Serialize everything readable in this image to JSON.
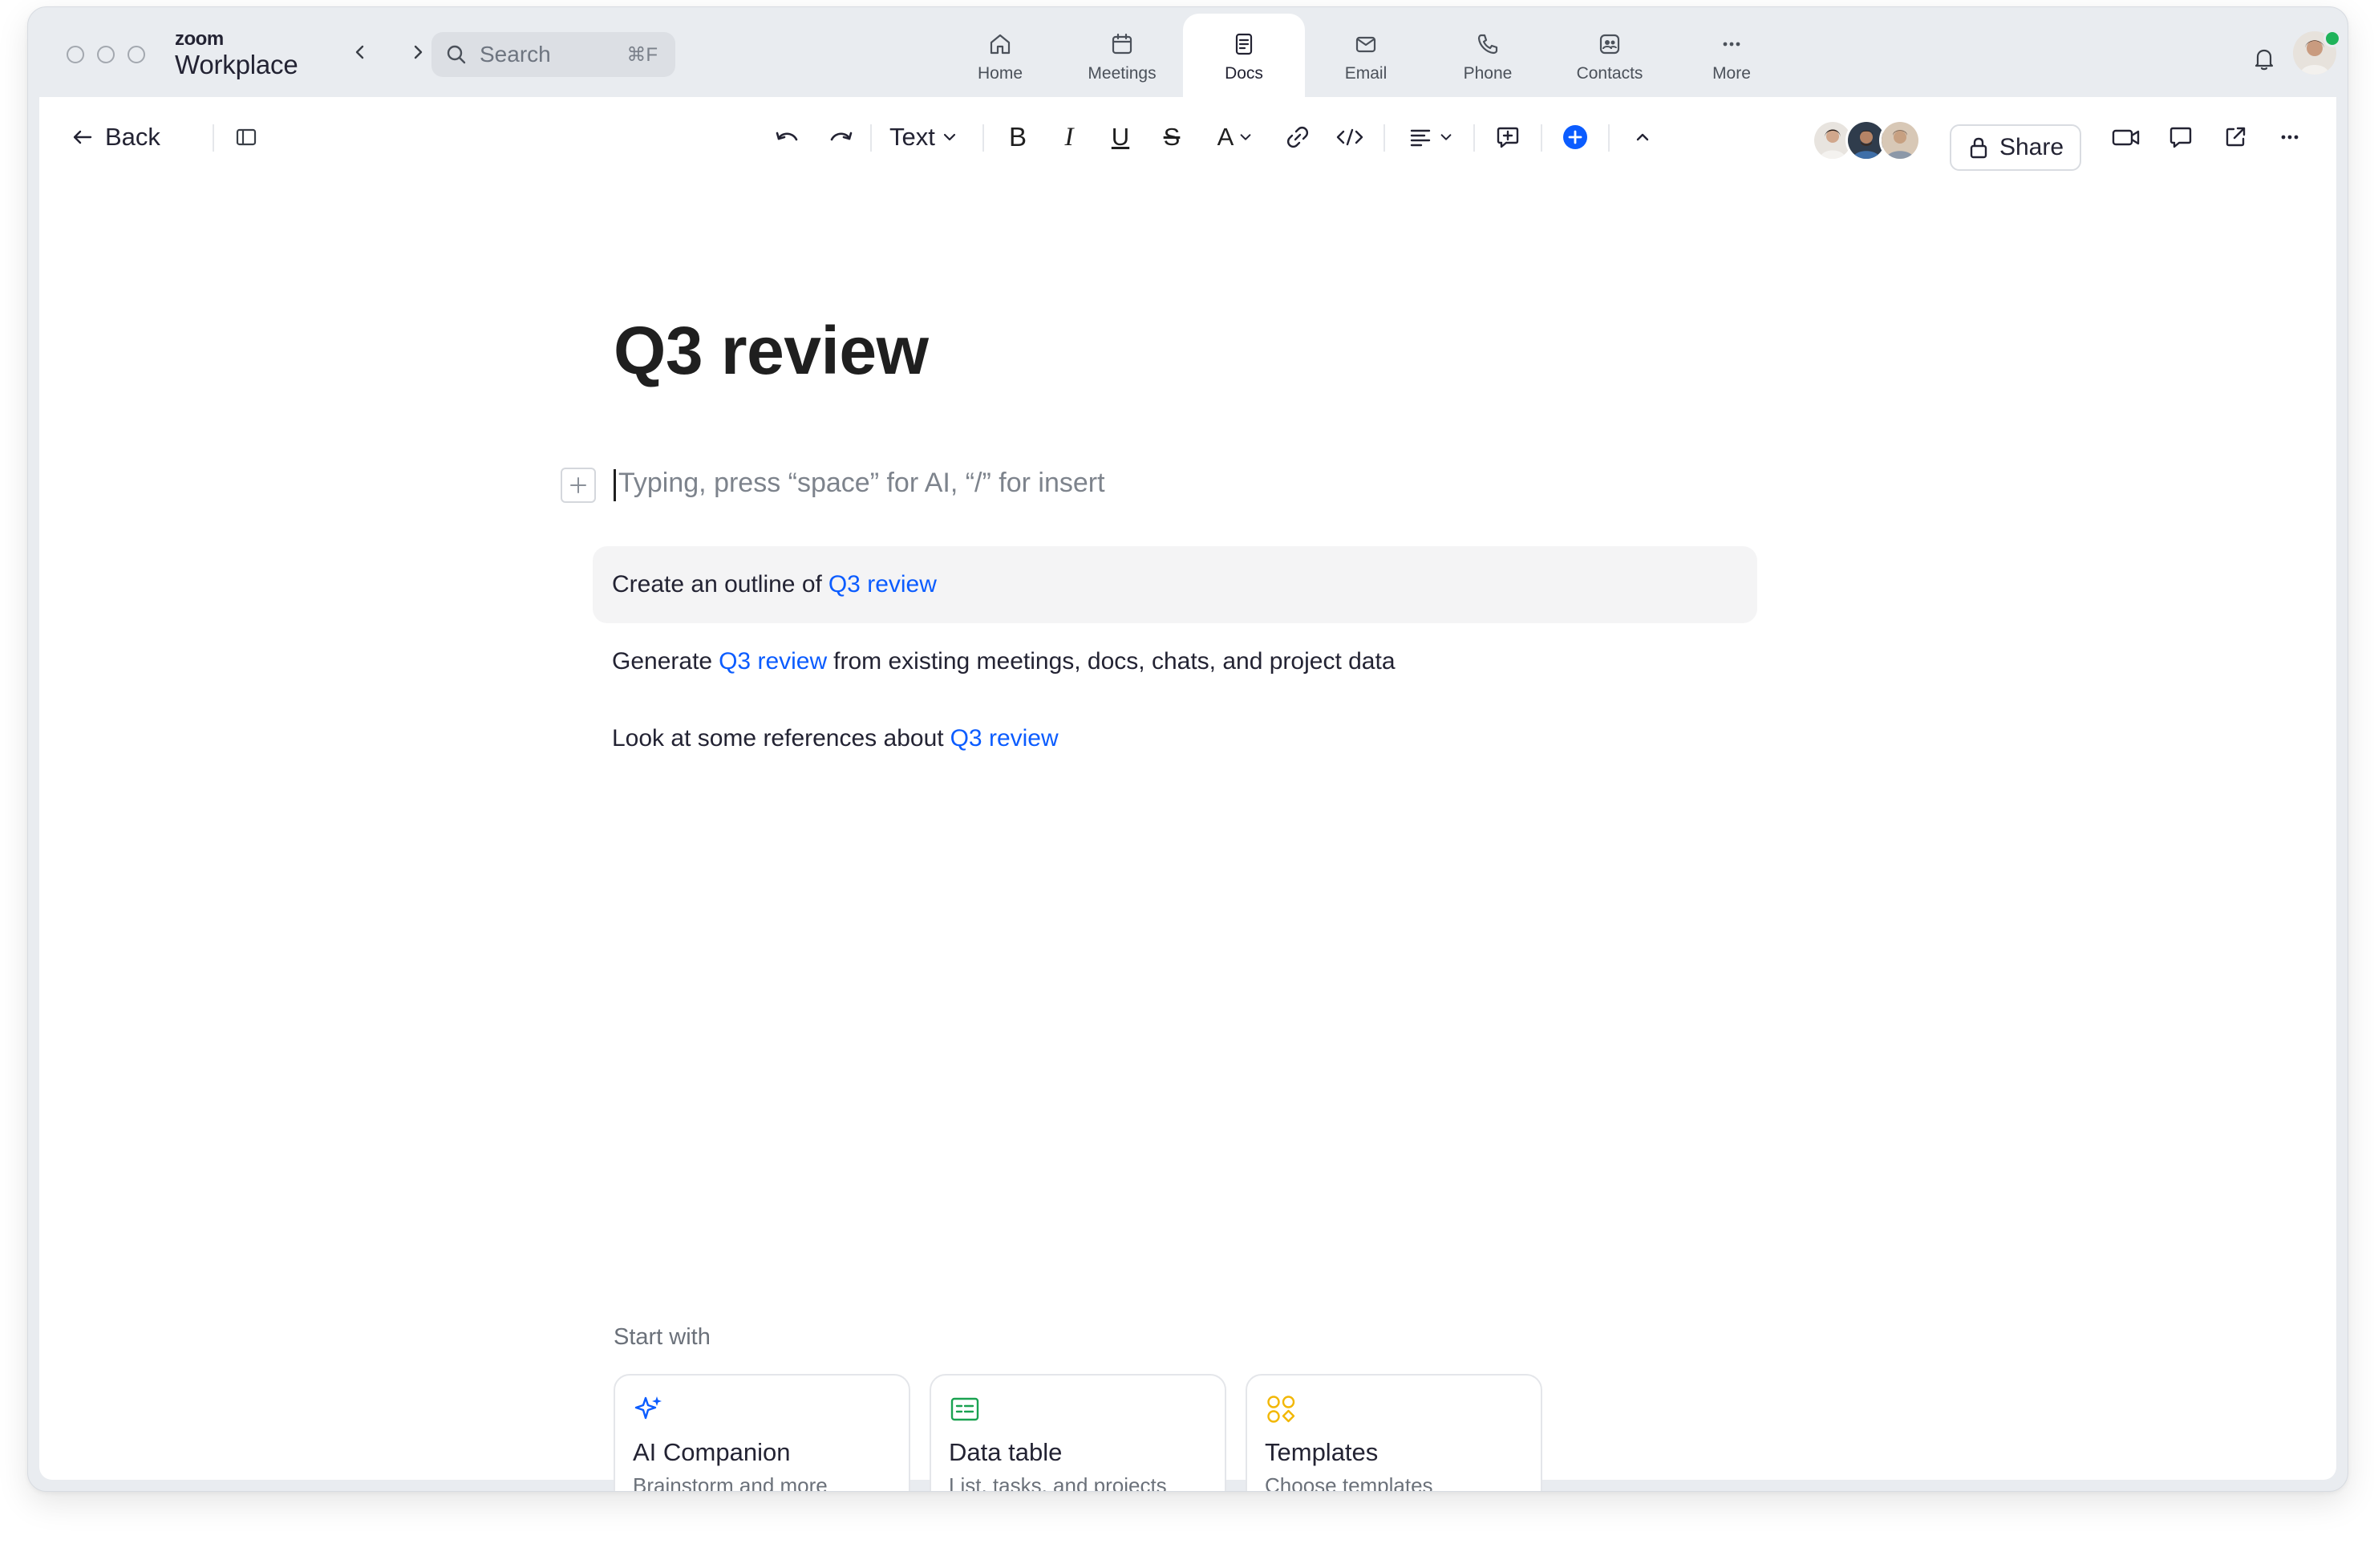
{
  "app": {
    "brand_small": "zoom",
    "brand_big": "Workplace"
  },
  "search": {
    "placeholder": "Search",
    "shortcut": "⌘F"
  },
  "tabs": [
    {
      "label": "Home",
      "icon": "home-icon"
    },
    {
      "label": "Meetings",
      "icon": "calendar-icon"
    },
    {
      "label": "Docs",
      "icon": "document-icon",
      "active": true
    },
    {
      "label": "Email",
      "icon": "envelope-icon"
    },
    {
      "label": "Phone",
      "icon": "phone-icon"
    },
    {
      "label": "Contacts",
      "icon": "contacts-icon"
    },
    {
      "label": "More",
      "icon": "more-horizontal-icon"
    }
  ],
  "toolbar": {
    "back_label": "Back",
    "text_style": "Text",
    "bold_glyph": "B",
    "italic_glyph": "I",
    "underline_glyph": "U",
    "strike_glyph": "S",
    "font_color_glyph": "A",
    "share_label": "Share"
  },
  "doc": {
    "title": "Q3 review",
    "editor_placeholder": "Typing, press “space” for AI, “/” for insert"
  },
  "suggestions": [
    {
      "pre": "Create an outline of",
      "ref": "Q3 review",
      "post": ""
    },
    {
      "pre": "Generate",
      "ref": "Q3 review",
      "post": "from existing meetings, docs, chats, and project data"
    },
    {
      "pre": "Look at some references about",
      "ref": "Q3 review",
      "post": ""
    }
  ],
  "start_with": {
    "label": "Start with",
    "cards": [
      {
        "title": "AI Companion",
        "subtitle": "Brainstorm and more",
        "icon": "sparkle-icon",
        "color": "#0b5cff"
      },
      {
        "title": "Data table",
        "subtitle": "List, tasks, and projects",
        "icon": "table-icon",
        "color": "#1aa251"
      },
      {
        "title": "Templates",
        "subtitle": "Choose templates",
        "icon": "shapes-icon",
        "color": "#f2b705"
      }
    ]
  },
  "colors": {
    "accent": "#0b5cff",
    "online": "#1fb35a",
    "chrome": "#e9ecf0"
  }
}
